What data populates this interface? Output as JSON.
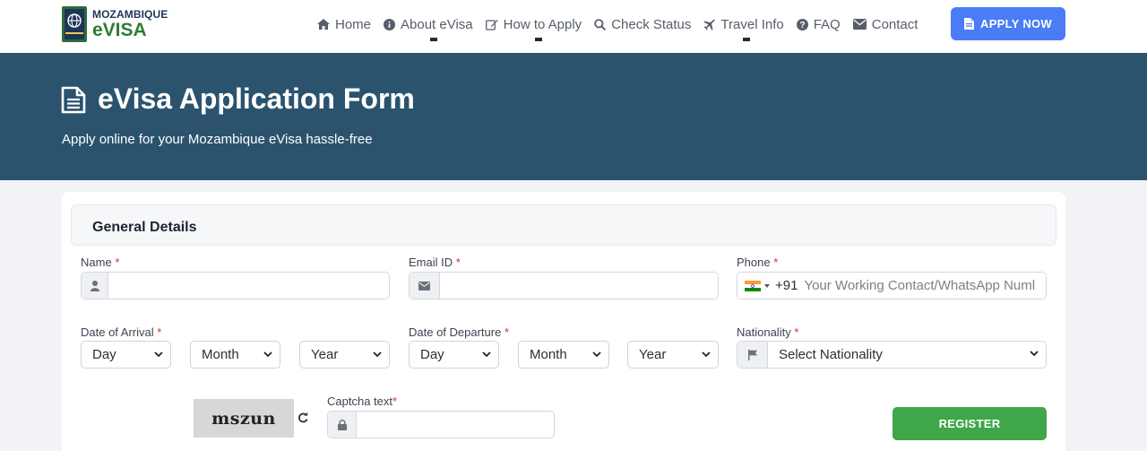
{
  "brand": {
    "line1": "MOZAMBIQUE",
    "line2": "eVISA"
  },
  "nav": [
    {
      "label": "Home",
      "icon": "home-icon"
    },
    {
      "label": "About eVisa",
      "icon": "info-icon"
    },
    {
      "label": "How to Apply",
      "icon": "edit-icon"
    },
    {
      "label": "Check Status",
      "icon": "search-icon"
    },
    {
      "label": "Travel Info",
      "icon": "plane-icon"
    },
    {
      "label": "FAQ",
      "icon": "question-icon"
    },
    {
      "label": "Contact",
      "icon": "envelope-icon"
    }
  ],
  "apply_button": "APPLY NOW",
  "hero": {
    "title": "eVisa Application Form",
    "subtitle": "Apply online for your Mozambique eVisa hassle-free"
  },
  "form": {
    "section_title": "General Details",
    "name_label": "Name",
    "email_label": "Email ID",
    "phone_label": "Phone",
    "phone_code": "+91",
    "phone_placeholder": "Your Working Contact/WhatsApp Numl",
    "arrival_label": "Date of Arrival",
    "departure_label": "Date of Departure",
    "nationality_label": "Nationality",
    "required_mark": "*",
    "day": "Day",
    "month": "Month",
    "year": "Year",
    "nationality_placeholder": "Select Nationality",
    "captcha_text": "mszun",
    "captcha_label": "Captcha text",
    "register_button": "REGISTER"
  },
  "colors": {
    "hero_bg": "#2b536e",
    "apply_bg": "#4a7cf6",
    "register_bg": "#3fa64a",
    "required": "#d63031"
  }
}
